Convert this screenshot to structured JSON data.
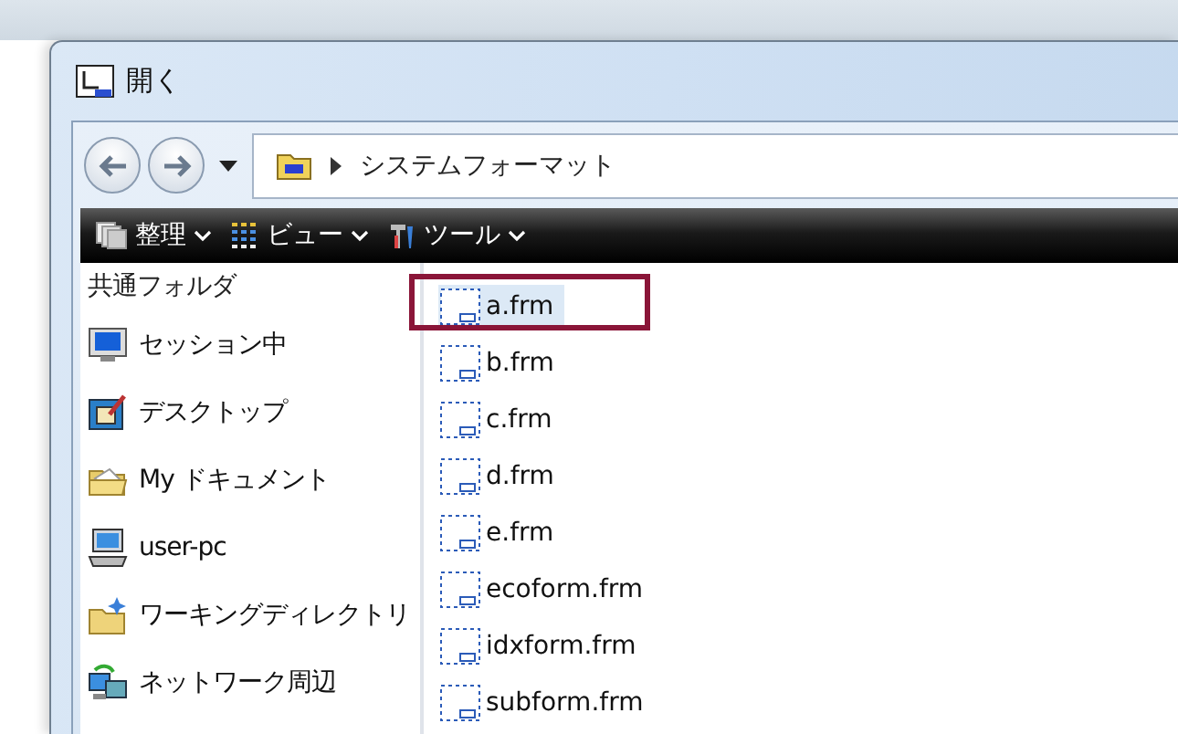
{
  "window": {
    "title": "開く"
  },
  "address": {
    "path": "システムフォーマット"
  },
  "toolbar": [
    {
      "label": "整理",
      "kind": "organize"
    },
    {
      "label": "ビュー",
      "kind": "view"
    },
    {
      "label": "ツール",
      "kind": "tools"
    }
  ],
  "sidebar": {
    "header": "共通フォルダ",
    "items": [
      {
        "label": "セッション中",
        "kind": "monitor"
      },
      {
        "label": "デスクトップ",
        "kind": "desktop"
      },
      {
        "label": "My ドキュメント",
        "kind": "documents"
      },
      {
        "label": "user-pc",
        "kind": "computer"
      },
      {
        "label": "ワーキングディレクトリ",
        "kind": "workfolder"
      },
      {
        "label": "ネットワーク周辺",
        "kind": "network"
      }
    ]
  },
  "files": [
    {
      "name": "a.frm",
      "selected": true,
      "outlined": true
    },
    {
      "name": "b.frm",
      "selected": false,
      "outlined": false
    },
    {
      "name": "c.frm",
      "selected": false,
      "outlined": false
    },
    {
      "name": "d.frm",
      "selected": false,
      "outlined": false
    },
    {
      "name": "e.frm",
      "selected": false,
      "outlined": false
    },
    {
      "name": "ecoform.frm",
      "selected": false,
      "outlined": false
    },
    {
      "name": "idxform.frm",
      "selected": false,
      "outlined": false
    },
    {
      "name": "subform.frm",
      "selected": false,
      "outlined": false
    }
  ]
}
